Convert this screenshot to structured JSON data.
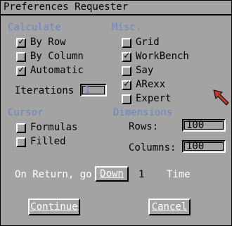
{
  "title": "Preferences Requester",
  "calculate": {
    "heading": "Calculate",
    "options": [
      {
        "label": "By Row",
        "checked": true
      },
      {
        "label": "By Column",
        "checked": false
      },
      {
        "label": "Automatic",
        "checked": true
      }
    ],
    "iterations_label": "Iterations",
    "iterations_value": "1"
  },
  "misc": {
    "heading": "Misc.",
    "options": [
      {
        "label": "Grid",
        "checked": false
      },
      {
        "label": "WorkBench",
        "checked": true
      },
      {
        "label": "Say",
        "checked": false
      },
      {
        "label": "ARexx",
        "checked": true
      },
      {
        "label": "Expert",
        "checked": false
      }
    ]
  },
  "cursor": {
    "heading": "Cursor",
    "options": [
      {
        "label": "Formulas",
        "checked": false
      },
      {
        "label": "Filled",
        "checked": false
      }
    ]
  },
  "dimensions": {
    "heading": "Dimensions",
    "rows_label": "Rows:",
    "rows_value": "100",
    "columns_label": "Columns:",
    "columns_value": "100"
  },
  "on_return": {
    "label": "On Return, go",
    "direction_button": "Down",
    "count": "1",
    "unit": "Time"
  },
  "buttons": {
    "continue": "Continue",
    "cancel": "Cancel"
  },
  "check_glyph": "✓",
  "colors": {
    "background": "#a3a3a3",
    "section": "#6a85c1",
    "pointer": "#c0392b"
  }
}
